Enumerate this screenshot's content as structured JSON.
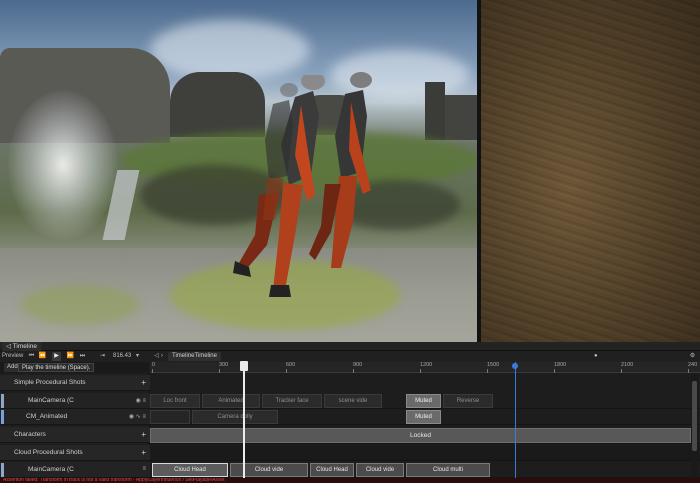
{
  "window": {
    "tab_label": "Timeline"
  },
  "toolbar": {
    "preview_label": "Preview",
    "frame_counter": "816.43",
    "timeline_tab_label": "TimelineTimeline",
    "tooltip": "Play the timeline (Space).",
    "add_label": "Add"
  },
  "ruler": {
    "ticks": [
      "0",
      "300",
      "600",
      "900",
      "1200",
      "1500",
      "1800",
      "2100",
      "240"
    ]
  },
  "tracks": {
    "simple_group": "Simple Procedural Shots",
    "maincamera_1": "MainCamera (C",
    "cm_animated": "CM_Animated",
    "characters": "Characters",
    "cloud_group": "Cloud Procedural Shots",
    "maincamera_2": "MainCamera (C"
  },
  "clips": {
    "lane1": [
      "Loc front",
      "Animated",
      "Tracker face",
      "scene vide",
      "Muted",
      "Reverse"
    ],
    "lane2": [
      "Camera dolly",
      "Muted"
    ],
    "characters_locked": "Locked",
    "cloud": [
      "Cloud Head",
      "Cloud vide",
      "Cloud Head",
      "Cloud vide",
      "Cloud multi"
    ]
  },
  "colors": {
    "playhead": "#ececec",
    "end_marker": "#3b7bd8",
    "stripe_camera": "#8ea7c6",
    "stripe_animated": "#7aa0d8"
  },
  "status": {
    "message": "Assertion failed: Transform in track is not a valid transform - ApplyLayerInfluence / SetPlayableAsset"
  }
}
